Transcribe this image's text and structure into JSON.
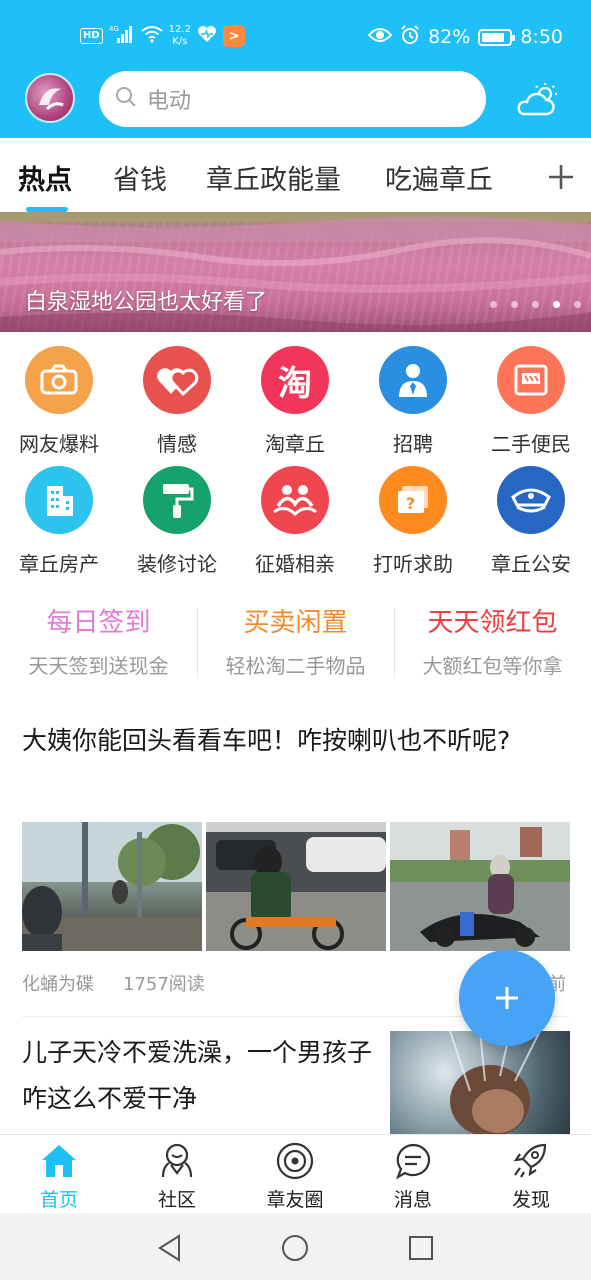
{
  "status_bar": {
    "hd": "HD",
    "signal": "4G",
    "speed_value": "12.2",
    "speed_unit": "K/s",
    "app_notification": ">",
    "battery": "82%",
    "battery_level": 0.82,
    "time": "8:50"
  },
  "header": {
    "search_placeholder": "电动"
  },
  "tabs": [
    {
      "label": "热点",
      "active": true
    },
    {
      "label": "省钱"
    },
    {
      "label": "章丘政能量"
    },
    {
      "label": "吃遍章丘"
    }
  ],
  "banner": {
    "title": "白泉湿地公园也太好看了",
    "slide_count": 5,
    "active_slide": 3
  },
  "grid": [
    {
      "label": "网友爆料",
      "icon": "camera-icon",
      "color": "#f5a34a"
    },
    {
      "label": "情感",
      "icon": "hearts-icon",
      "color": "#e9514f"
    },
    {
      "label": "淘章丘",
      "icon": "tao-icon",
      "icon_text": "淘",
      "color": "#f2365a"
    },
    {
      "label": "招聘",
      "icon": "person-tie-icon",
      "color": "#2a8fe0"
    },
    {
      "label": "二手便民",
      "icon": "shop-icon",
      "color": "#ff7357"
    },
    {
      "label": "章丘房产",
      "icon": "building-icon",
      "color": "#2cc3ec"
    },
    {
      "label": "装修讨论",
      "icon": "paint-roller-icon",
      "color": "#15a26d"
    },
    {
      "label": "征婚相亲",
      "icon": "couple-icon",
      "color": "#ef4650"
    },
    {
      "label": "打听求助",
      "icon": "question-board-icon",
      "color": "#ff8a1e"
    },
    {
      "label": "章丘公安",
      "icon": "police-cap-icon",
      "color": "#2767c4"
    }
  ],
  "promos": [
    {
      "title": "每日签到",
      "subtitle": "天天签到送现金",
      "color": "#e27ad8"
    },
    {
      "title": "买卖闲置",
      "subtitle": "轻松淘二手物品",
      "color": "#f08a2a"
    },
    {
      "title": "天天领红包",
      "subtitle": "大额红包等你拿",
      "color": "#ee3d3d"
    }
  ],
  "articles": [
    {
      "title": "大姨你能回头看看车吧！咋按喇叭也不听呢?",
      "author": "化蛹为碟",
      "reads": "1757阅读",
      "time_suffix": "前"
    },
    {
      "title": "儿子天冷不爱洗澡，一个男孩子咋这么不爱干净"
    }
  ],
  "bottom_nav": [
    {
      "label": "首页",
      "icon": "home-icon",
      "active": true
    },
    {
      "label": "社区",
      "icon": "community-icon"
    },
    {
      "label": "章友圈",
      "icon": "circle-icon"
    },
    {
      "label": "消息",
      "icon": "message-icon"
    },
    {
      "label": "发现",
      "icon": "rocket-icon"
    }
  ],
  "colors": {
    "brand": "#1ec0f7",
    "fab": "#46a3f5"
  }
}
